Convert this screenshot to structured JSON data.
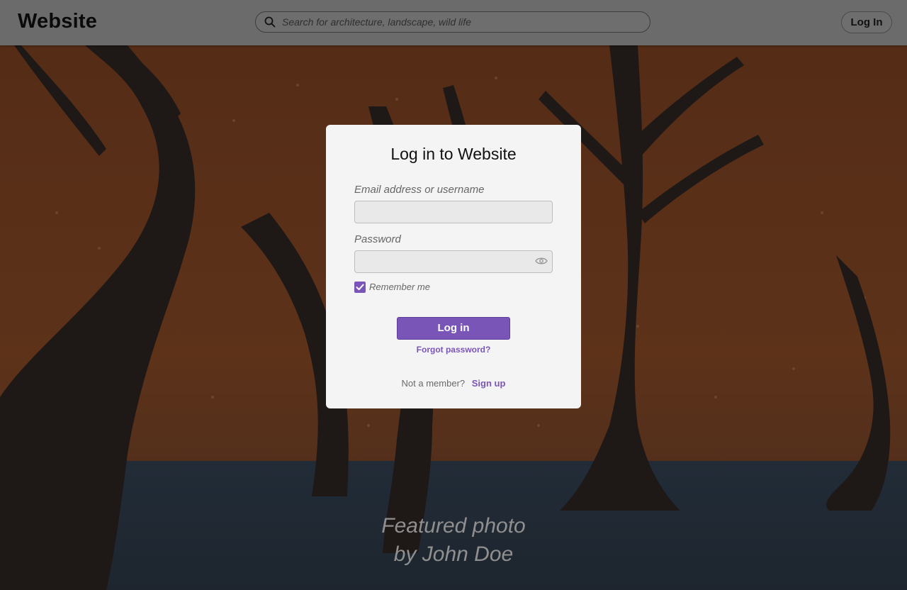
{
  "header": {
    "logo_text": "Website",
    "search_placeholder": "Search for architecture, landscape, wild life",
    "login_button_label": "Log In"
  },
  "login_modal": {
    "title": "Log in to Website",
    "email_label": "Email address or username",
    "email_value": "",
    "password_label": "Password",
    "password_value": "",
    "remember_me_label": "Remember me",
    "remember_me_checked": true,
    "submit_label": "Log in",
    "forgot_password_label": "Forgot password?",
    "not_member_text": "Not a member?",
    "sign_up_label": "Sign up"
  },
  "featured_photo": {
    "line1": "Featured photo",
    "line2": "by John Doe"
  },
  "colors": {
    "accent": "#7a55b8",
    "header_bg": "#6b6b6b",
    "modal_bg": "#f4f4f5"
  },
  "icons": {
    "search": "search-icon",
    "password_visibility": "eye-icon",
    "checkbox": "checkmark-icon"
  }
}
